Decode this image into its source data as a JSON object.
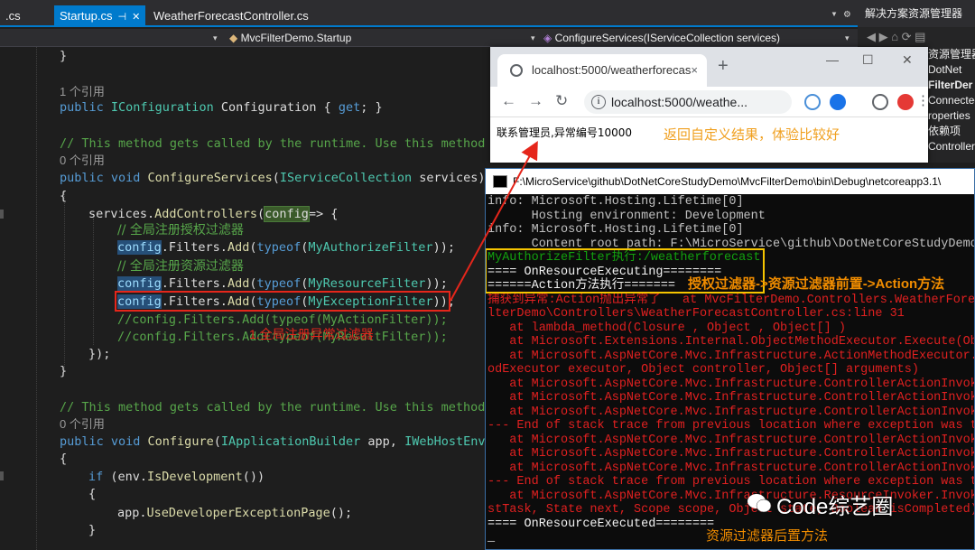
{
  "tabs": [
    {
      "label": ".cs"
    },
    {
      "label": "Startup.cs",
      "active": true
    },
    {
      "label": "WeatherForecastController.cs"
    }
  ],
  "navbar": {
    "project": "MvcFilterDemo.Startup",
    "member": "ConfigureServices(IServiceCollection services)"
  },
  "solution_explorer": {
    "title": "解决方案资源管理器",
    "lines": [
      "资源管理器",
      "DotNet",
      "FilterDer",
      "Connected",
      "roperties",
      "依赖项",
      "Controllers"
    ]
  },
  "code": {
    "brace_close": "}",
    "ref1": "1 个引用",
    "line_config": "public IConfiguration Configuration { get; }",
    "comment1": "// This method gets called by the runtime. Use this method to",
    "ref0": "0 个引用",
    "line_cs": "public void ConfigureServices(IServiceCollection services)",
    "brace_open": "{",
    "add_controllers": "services.AddControllers(config=> {",
    "cm_auth": "// 全局注册授权过滤器",
    "add_auth": "config.Filters.Add(typeof(MyAuthorizeFilter));",
    "cm_res": "// 全局注册资源过滤器",
    "add_res": "config.Filters.Add(typeof(MyResourceFilter));",
    "add_exc": "config.Filters.Add(typeof(MyExceptionFilter));",
    "add_act": "//config.Filters.Add(typeof(MyActionFilter));",
    "add_result": "//config.Filters.Add(typeof(MyResultFilter));",
    "close_paren": "});",
    "brace_close2": "}",
    "comment2": "// This method gets called by the runtime. Use this method t",
    "ref0b": "0 个引用",
    "line_configure": "public void Configure(IApplicationBuilder app, IWebHostEnvi",
    "brace_open2": "{",
    "if_dev": "if (env.IsDevelopment())",
    "brace_open3": "{",
    "use_dev": "app.UseDeveloperExceptionPage();",
    "brace_close3": "}"
  },
  "annotation_exception": "1.全局注册异常过滤器",
  "browser": {
    "tab_title": "localhost:5000/weatherforecas",
    "url": "localhost:5000/weathe...",
    "body_text": "联系管理员,异常编号10000",
    "note": "返回自定义结果，体验比较好",
    "controls": {
      "minimize": "—",
      "maximize": "☐",
      "close": "✕",
      "back": "←",
      "forward": "→",
      "reload": "↻",
      "newtab": "+",
      "tabclose": "×",
      "star": "☆",
      "menu": "⋮"
    }
  },
  "console": {
    "title": "F:\\MicroService\\github\\DotNetCoreStudyDemo\\MvcFilterDemo\\bin\\Debug\\netcoreapp3.1\\",
    "lines": [
      {
        "t": "info: Microsoft.Hosting.Lifetime[0]",
        "c": "gr"
      },
      {
        "t": "      Hosting environment: Development",
        "c": "gr"
      },
      {
        "t": "info: Microsoft.Hosting.Lifetime[0]",
        "c": "gr"
      },
      {
        "t": "      Content root path: F:\\MicroService\\github\\DotNetCoreStudyDemo\\Mv",
        "c": "gr"
      },
      {
        "t": "MyAuthorizeFilter执行:/weatherforecast",
        "c": "gn"
      },
      {
        "t": "==== OnResourceExecuting========",
        "c": "wh"
      },
      {
        "t": "======Action方法执行=======",
        "c": "wh"
      },
      {
        "t": "捕获到异常:Action抛出异常了   at MvcFilterDemo.Controllers.WeatherFore",
        "c": "rd"
      },
      {
        "t": "lterDemo\\Controllers\\WeatherForecastController.cs:line 31",
        "c": "rd"
      },
      {
        "t": "   at lambda_method(Closure , Object , Object[] )",
        "c": "rd"
      },
      {
        "t": "   at Microsoft.Extensions.Internal.ObjectMethodExecutor.Execute(Obje",
        "c": "rd"
      },
      {
        "t": "   at Microsoft.AspNetCore.Mvc.Infrastructure.ActionMethodExecutor.Syn",
        "c": "rd"
      },
      {
        "t": "odExecutor executor, Object controller, Object[] arguments)",
        "c": "rd"
      },
      {
        "t": "   at Microsoft.AspNetCore.Mvc.Infrastructure.ControllerActionInvoker.",
        "c": "rd"
      },
      {
        "t": "   at Microsoft.AspNetCore.Mvc.Infrastructure.ControllerActionInvoker.",
        "c": "rd"
      },
      {
        "t": "   at Microsoft.AspNetCore.Mvc.Infrastructure.ControllerActionInvoker.",
        "c": "rd"
      },
      {
        "t": "--- End of stack trace from previous location where exception was thro",
        "c": "rd"
      },
      {
        "t": "   at Microsoft.AspNetCore.Mvc.Infrastructure.ControllerActionInvoker.",
        "c": "rd"
      },
      {
        "t": "   at Microsoft.AspNetCore.Mvc.Infrastructure.ControllerActionInvoker.",
        "c": "rd"
      },
      {
        "t": "   at Microsoft.AspNetCore.Mvc.Infrastructure.ControllerActionInvoker.",
        "c": "rd"
      },
      {
        "t": "--- End of stack trace from previous location where exception was thro",
        "c": "rd"
      },
      {
        "t": "   at Microsoft.AspNetCore.Mvc.Infrastructure.ResourceInvoker.InvokeN",
        "c": "rd"
      },
      {
        "t": "stTask, State next, Scope scope, Object state, Boolean isCompleted), n",
        "c": "rd"
      },
      {
        "t": "==== OnResourceExecuted========",
        "c": "wh"
      },
      {
        "t": "_",
        "c": "wh"
      }
    ]
  },
  "annotation_flow": "授权过滤器->资源过滤器前置->Action方法",
  "annotation_after": "资源过滤器后置方法",
  "watermark": "Code综艺圈",
  "colors": {
    "accent": "#007acc",
    "annotation_red": "#e5261b",
    "annotation_yellow": "#f5c400",
    "annotation_orange": "#f08c00"
  }
}
